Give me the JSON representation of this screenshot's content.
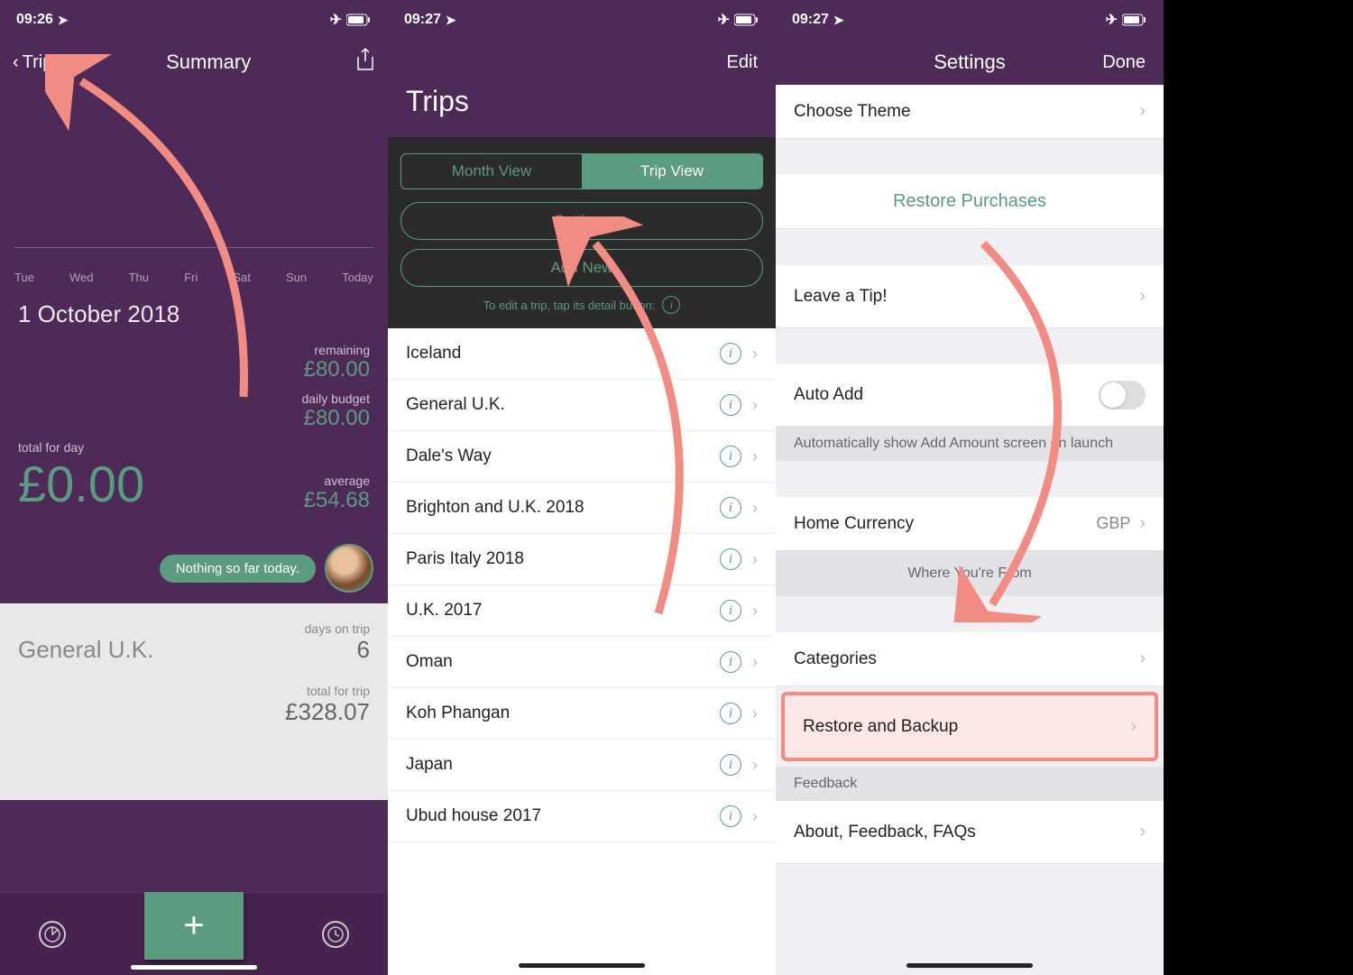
{
  "screen1": {
    "status_time": "09:26",
    "back_label": "Trips",
    "title": "Summary",
    "days": [
      "Tue",
      "Wed",
      "Thu",
      "Fri",
      "Sat",
      "Sun",
      "Today"
    ],
    "date": "1 October 2018",
    "total_label": "total for day",
    "total_val": "£0.00",
    "remaining_label": "remaining",
    "remaining_val": "£80.00",
    "daily_label": "daily budget",
    "daily_val": "£80.00",
    "avg_label": "average",
    "avg_val": "£54.68",
    "hint": "Nothing so far today.",
    "trip_name": "General U.K.",
    "days_on_label": "days on trip",
    "days_on_val": "6",
    "trip_total_label": "total for trip",
    "trip_total_val": "£328.07"
  },
  "screen2": {
    "status_time": "09:27",
    "edit_label": "Edit",
    "title": "Trips",
    "seg_month": "Month View",
    "seg_trip": "Trip View",
    "settings_btn": "Settings",
    "addnew_btn": "Add New",
    "hint": "To edit a trip, tap its detail button:",
    "trips": [
      "Iceland",
      "General U.K.",
      "Dale's Way",
      "Brighton and U.K. 2018",
      "Paris Italy 2018",
      "U.K. 2017",
      "Oman",
      "Koh Phangan",
      "Japan",
      "Ubud house 2017"
    ]
  },
  "screen3": {
    "status_time": "09:27",
    "title": "Settings",
    "done": "Done",
    "choose_theme": "Choose Theme",
    "restore_purchases": "Restore Purchases",
    "leave_tip": "Leave a Tip!",
    "auto_add": "Auto Add",
    "auto_add_desc": "Automatically show Add Amount screen on launch",
    "home_currency": "Home Currency",
    "home_currency_val": "GBP",
    "where_from": "Where You're From",
    "categories": "Categories",
    "restore_backup": "Restore and Backup",
    "feedback_section": "Feedback",
    "about_row": "About, Feedback, FAQs"
  }
}
